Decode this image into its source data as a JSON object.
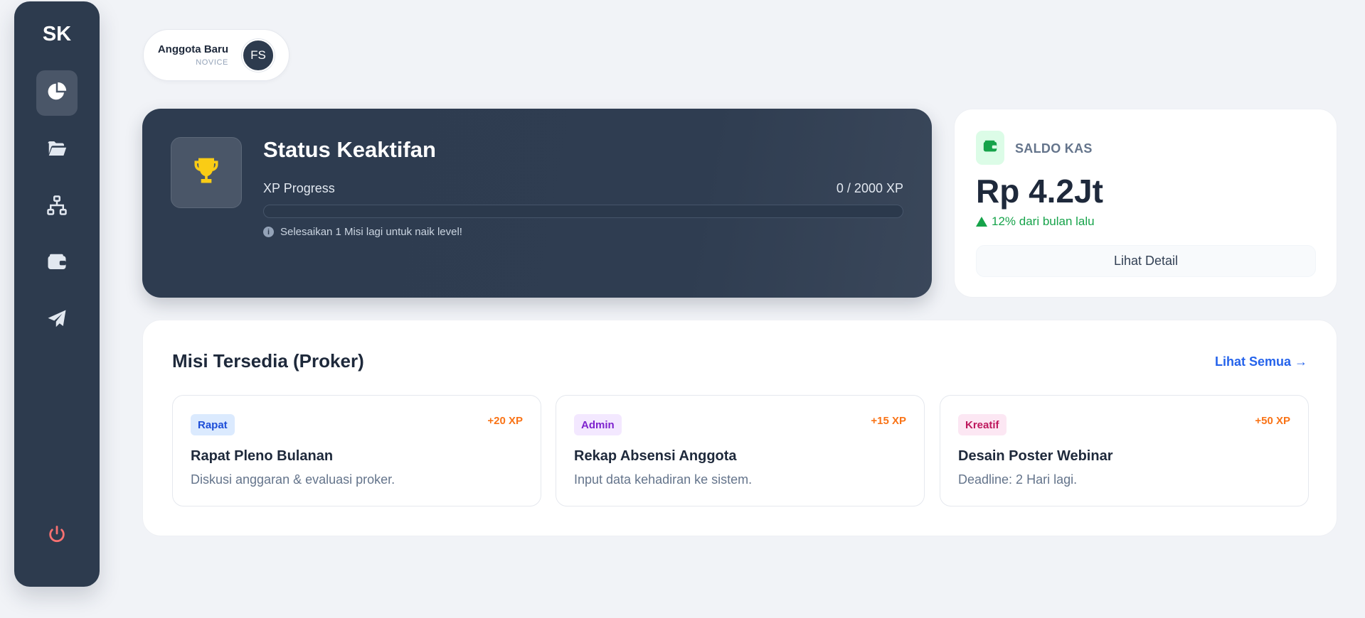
{
  "sidebar": {
    "logo": "SK",
    "items": [
      {
        "icon": "chart-pie-icon",
        "active": true
      },
      {
        "icon": "folder-open-icon",
        "active": false
      },
      {
        "icon": "sitemap-icon",
        "active": false
      },
      {
        "icon": "wallet-icon",
        "active": false
      },
      {
        "icon": "paper-plane-icon",
        "active": false
      }
    ],
    "logout_icon": "power-icon"
  },
  "user": {
    "name": "Anggota Baru",
    "level": "NOVICE",
    "initials": "FS"
  },
  "status": {
    "title": "Status Keaktifan",
    "xp_label": "XP Progress",
    "xp_value": "0 / 2000 XP",
    "xp_current": 0,
    "xp_max": 2000,
    "hint": "Selesaikan 1 Misi lagi untuk naik level!",
    "icon": "trophy-icon"
  },
  "saldo": {
    "label": "SALDO KAS",
    "amount": "Rp 4.2Jt",
    "change": "12% dari bulan lalu",
    "button": "Lihat Detail",
    "icon": "wallet-icon"
  },
  "missions": {
    "title": "Misi Tersedia (Proker)",
    "see_all": "Lihat Semua →",
    "items": [
      {
        "tag": "Rapat",
        "tag_color": "#1d4ed8",
        "tag_bg": "#dbeafe",
        "xp": "+20 XP",
        "title": "Rapat Pleno Bulanan",
        "desc": "Diskusi anggaran & evaluasi proker."
      },
      {
        "tag": "Admin",
        "tag_color": "#7e22ce",
        "tag_bg": "#f3e8ff",
        "xp": "+15 XP",
        "title": "Rekap Absensi Anggota",
        "desc": "Input data kehadiran ke sistem."
      },
      {
        "tag": "Kreatif",
        "tag_color": "#be185d",
        "tag_bg": "#fce7f3",
        "xp": "+50 XP",
        "title": "Desain Poster Webinar",
        "desc": "Deadline: 2 Hari lagi."
      }
    ]
  },
  "colors": {
    "sidebar_bg": "#2d3b4e",
    "accent_blue": "#2563eb",
    "accent_green": "#16a34a",
    "accent_orange": "#f97316",
    "trophy": "#facc15",
    "logout": "#f87171"
  }
}
